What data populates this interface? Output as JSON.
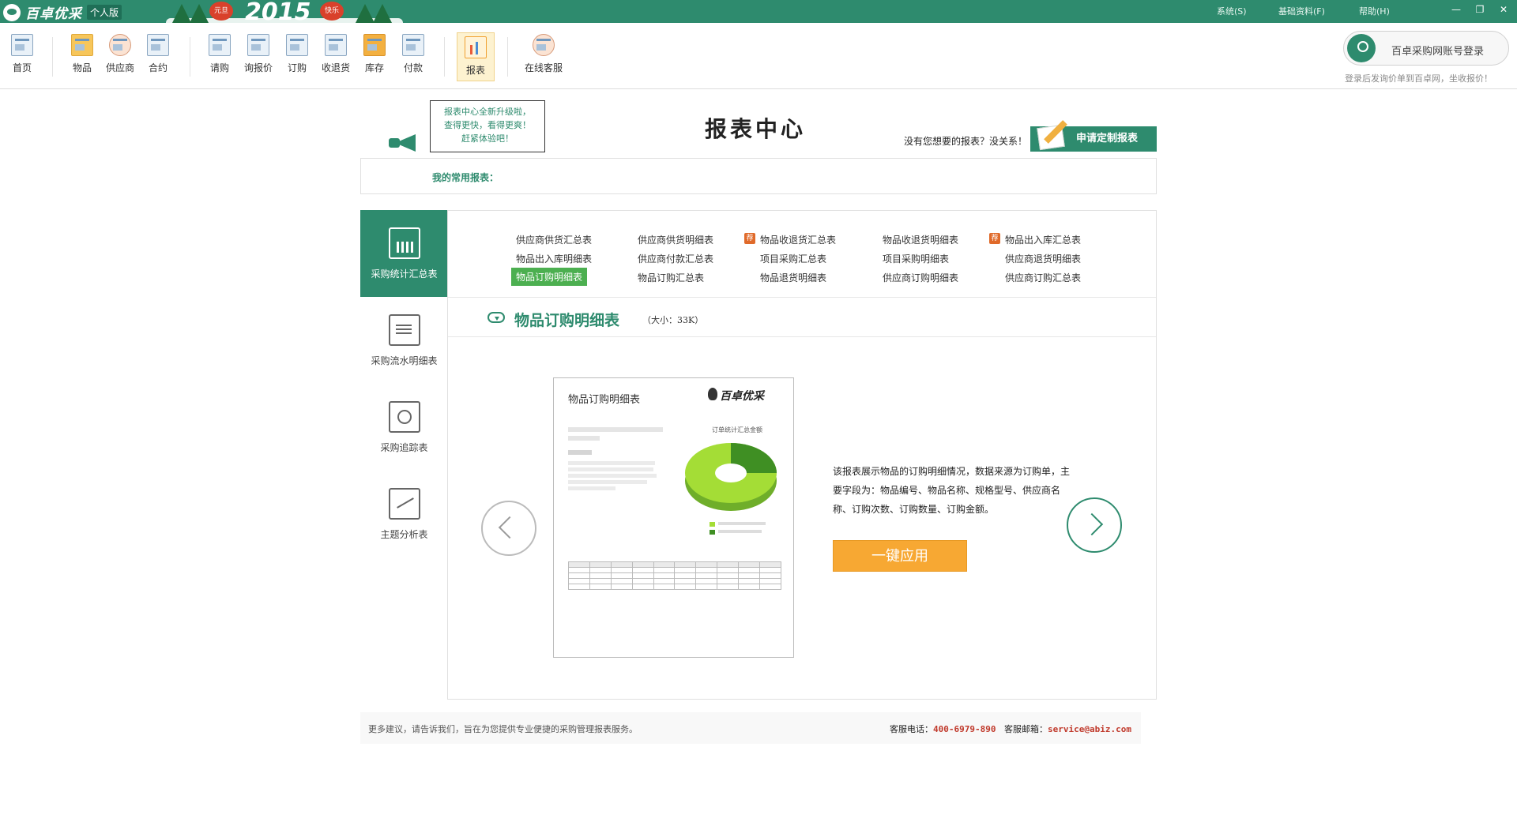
{
  "titlebar": {
    "app_name": "百卓优采",
    "edition": "个人版",
    "festive_year": "2015",
    "lantern_left": "元旦",
    "lantern_right": "快乐",
    "menu": [
      "系统(S)",
      "基础资料(F)",
      "帮助(H)"
    ],
    "window_buttons": [
      "—",
      "❐",
      "✕"
    ]
  },
  "toolbar": {
    "items": [
      "首页",
      "物品",
      "供应商",
      "合约",
      "请购",
      "询报价",
      "订购",
      "收退货",
      "库存",
      "付款",
      "报表",
      "在线客服"
    ],
    "active": "报表",
    "login_label": "百卓采购网账号登录",
    "login_hint": "登录后发询价单到百卓网，坐收报价！"
  },
  "header": {
    "speech": [
      "报表中心全新升级啦，",
      "查得更快，看得更爽！",
      "赶紧体验吧！"
    ],
    "title": "报表中心",
    "custom_hint": "没有您想要的报表？没关系！",
    "custom_button": "申请定制报表",
    "common_label": "我的常用报表："
  },
  "left_nav": [
    {
      "label": "采购统计汇总表",
      "icon": "bar-chart-icon",
      "active": true
    },
    {
      "label": "采购流水明细表",
      "icon": "ledger-icon",
      "active": false
    },
    {
      "label": "采购追踪表",
      "icon": "tracking-icon",
      "active": false
    },
    {
      "label": "主题分析表",
      "icon": "analysis-icon",
      "active": false
    }
  ],
  "report_links": {
    "col1": [
      "供应商供货汇总表",
      "物品出入库明细表",
      "物品订购明细表"
    ],
    "col2": [
      "供应商供货明细表",
      "供应商付款汇总表",
      "物品订购汇总表"
    ],
    "col3": [
      "物品收退货汇总表",
      "项目采购汇总表",
      "物品退货明细表"
    ],
    "col4": [
      "物品收退货明细表",
      "项目采购明细表",
      "供应商订购明细表"
    ],
    "col5": [
      "物品出入库汇总表",
      "供应商退货明细表",
      "供应商订购汇总表"
    ],
    "selected": "物品订购明细表",
    "hot_badge": "荐"
  },
  "report": {
    "name": "物品订购明细表",
    "size": "（大小：33K）",
    "description": "该报表展示物品的订购明细情况，数据来源为订购单，主要字段为：物品编号、物品名称、规格型号、供应商名称、订购次数、订购数量、订购金额。",
    "apply_button": "一键应用"
  },
  "preview": {
    "title": "物品订购明细表",
    "logo": "百卓优采",
    "chart_title": "订单统计汇总金额"
  },
  "footer": {
    "text": "更多建议，请告诉我们，旨在为您提供专业便捷的采购管理报表服务。",
    "phone_label": "客服电话：",
    "phone": "400-6979-890",
    "email_label": "客服邮箱：",
    "email": "service@abiz.com"
  }
}
